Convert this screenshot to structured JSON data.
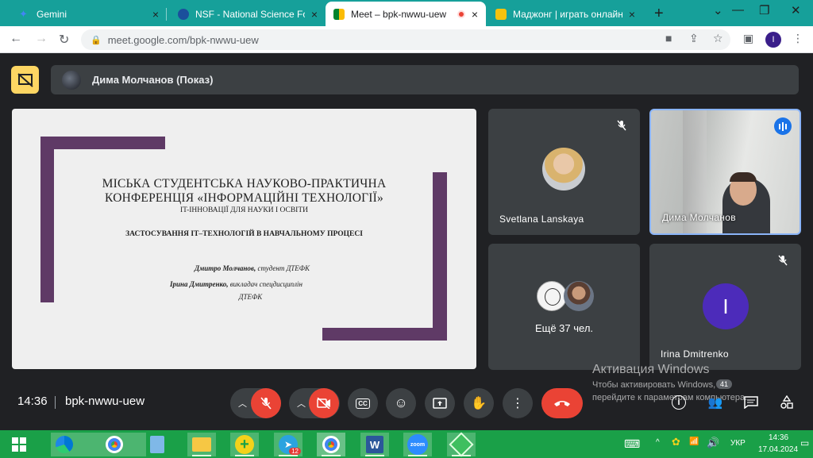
{
  "browser": {
    "tabs": [
      {
        "title": "Gemini",
        "close": "×"
      },
      {
        "title": "NSF - National Science Foun",
        "close": "×"
      },
      {
        "title": "Meet – bpk-nwwu-uew",
        "close": "×"
      },
      {
        "title": "Маджонг | играть онлайн б",
        "close": "×"
      }
    ],
    "new_tab": "+",
    "address": "meet.google.com/bpk-nwwu-uew",
    "profile_initial": "I"
  },
  "meet": {
    "presenter": "Дима Молчанов (Показ)",
    "slide": {
      "title_line1": "МІСЬКА СТУДЕНТСЬКА НАУКОВО-ПРАКТИЧНА",
      "title_line2": "КОНФЕРЕНЦІЯ «ІНФОРМАЦІЙНІ ТЕХНОЛОГІЇ»",
      "subtitle": "IT-ІННОВАЦІЇ ДЛЯ НАУКИ І ОСВІТИ",
      "topic": "ЗАСТОСУВАННЯ IT–ТЕХНОЛОГІЙ  В  НАВЧАЛЬНОМУ   ПРОЦЕСІ",
      "author1_name": "Дмитро Молчанов,",
      "author1_role": " студент ДТЕФК",
      "author2_name": "Ірина Дмитренко,",
      "author2_role": " викладач спецдисциплін",
      "author2_org": "ДТЕФК"
    },
    "participants": [
      {
        "name": "Svetlana Lanskaya"
      },
      {
        "name": "Дима Молчанов"
      },
      {
        "name": "Ещё 37 чел."
      },
      {
        "name": "Irina Dmitrenko",
        "initial": "I"
      }
    ],
    "time": "14:36",
    "code": "bpk-nwwu-uew",
    "people_count": "41",
    "watermark_title": "Активация Windows",
    "watermark_line1": "Чтобы активировать Windows,",
    "watermark_line2": "перейдите к параметрам компьютера."
  },
  "taskbar": {
    "telegram_badge": "12",
    "lang": "УКР",
    "time": "14:36",
    "date": "17.04.2024"
  },
  "colors": {
    "tabbar": "#16a09a",
    "taskbar": "#1aa048",
    "accent_red": "#ea4335",
    "present_yellow": "#fdd663"
  }
}
